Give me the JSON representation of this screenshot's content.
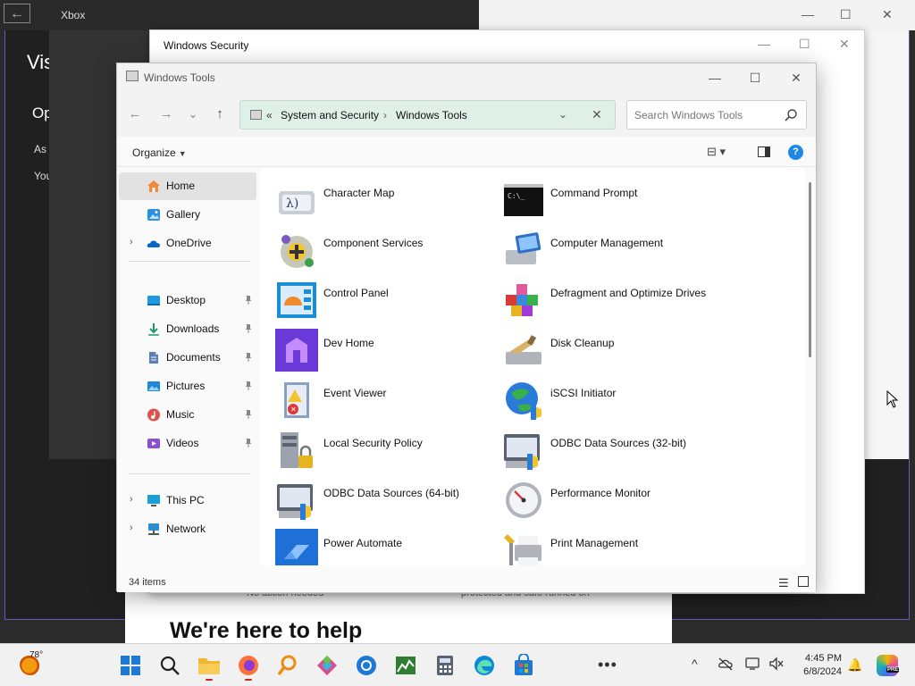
{
  "background": {
    "dark_window": {
      "heading": "Vis",
      "subheading": "Op",
      "line1": "As y",
      "line2": "You"
    },
    "xbox_window": {
      "title": "Xbox",
      "back": "←"
    },
    "help_page": {
      "heading": "We're here to help",
      "snippet_left": "No action needed",
      "snippet_right": "protected and safe runned on"
    },
    "windows_security": {
      "title": "Windows Security"
    }
  },
  "explorer": {
    "title": "Windows Tools",
    "controls": {
      "minimize": "—",
      "maximize": "☐",
      "close": "✕"
    },
    "nav": {
      "back": "←",
      "forward": "→",
      "recent": "⌄",
      "up": "↑"
    },
    "address": {
      "overflow": "«",
      "crumbs": [
        "System and Security",
        "Windows Tools"
      ],
      "separator": "›",
      "dropdown": "⌄",
      "clear": "✕"
    },
    "search": {
      "placeholder": "Search Windows Tools"
    },
    "command_bar": {
      "organize": "Organize",
      "organize_caret": "▼",
      "view": "⊟ ▾",
      "help": "?"
    },
    "sidebar": {
      "items": [
        {
          "label": "Home",
          "icon": "home-icon",
          "selected": true
        },
        {
          "label": "Gallery",
          "icon": "gallery-icon"
        },
        {
          "label": "OneDrive",
          "icon": "onedrive-icon",
          "expandable": true
        },
        {
          "label": "Desktop",
          "icon": "desktop-icon",
          "pinned": true
        },
        {
          "label": "Downloads",
          "icon": "downloads-icon",
          "pinned": true
        },
        {
          "label": "Documents",
          "icon": "documents-icon",
          "pinned": true
        },
        {
          "label": "Pictures",
          "icon": "pictures-icon",
          "pinned": true
        },
        {
          "label": "Music",
          "icon": "music-icon",
          "pinned": true
        },
        {
          "label": "Videos",
          "icon": "videos-icon",
          "pinned": true
        },
        {
          "label": "This PC",
          "icon": "this-pc-icon",
          "expandable": true
        },
        {
          "label": "Network",
          "icon": "network-icon",
          "expandable": true
        }
      ],
      "chevron": "›"
    },
    "tools": [
      {
        "name": "Character Map",
        "icon": "character-map-icon"
      },
      {
        "name": "Command Prompt",
        "icon": "command-prompt-icon"
      },
      {
        "name": "Component Services",
        "icon": "component-services-icon"
      },
      {
        "name": "Computer Management",
        "icon": "computer-management-icon"
      },
      {
        "name": "Control Panel",
        "icon": "control-panel-icon"
      },
      {
        "name": "Defragment and Optimize Drives",
        "icon": "defragment-icon"
      },
      {
        "name": "Dev Home",
        "icon": "dev-home-icon"
      },
      {
        "name": "Disk Cleanup",
        "icon": "disk-cleanup-icon"
      },
      {
        "name": "Event Viewer",
        "icon": "event-viewer-icon"
      },
      {
        "name": "iSCSI Initiator",
        "icon": "iscsi-initiator-icon"
      },
      {
        "name": "Local Security Policy",
        "icon": "local-security-policy-icon"
      },
      {
        "name": "ODBC Data Sources (32-bit)",
        "icon": "odbc-32-icon"
      },
      {
        "name": "ODBC Data Sources (64-bit)",
        "icon": "odbc-64-icon"
      },
      {
        "name": "Performance Monitor",
        "icon": "performance-monitor-icon"
      },
      {
        "name": "Power Automate",
        "icon": "power-automate-icon"
      },
      {
        "name": "Print Management",
        "icon": "print-management-icon"
      }
    ],
    "status": {
      "count": "34 items",
      "details_view": "☰"
    }
  },
  "taskbar": {
    "weather_temp": "78°",
    "apps": [
      "start-icon",
      "search-icon",
      "file-explorer-icon",
      "firefox-icon",
      "search-app-icon",
      "photos-icon",
      "browser-icon",
      "task-manager-icon",
      "calculator-icon",
      "edge-icon",
      "store-icon"
    ],
    "more": "•••",
    "tray": {
      "chevron": "^"
    },
    "time": "4:45 PM",
    "date": "6/8/2024",
    "copilot_badge": "PRE"
  },
  "colors": {
    "accent": "#1e88e5",
    "address_bg": "#dff0e6",
    "selected": "#e2e2e2"
  }
}
